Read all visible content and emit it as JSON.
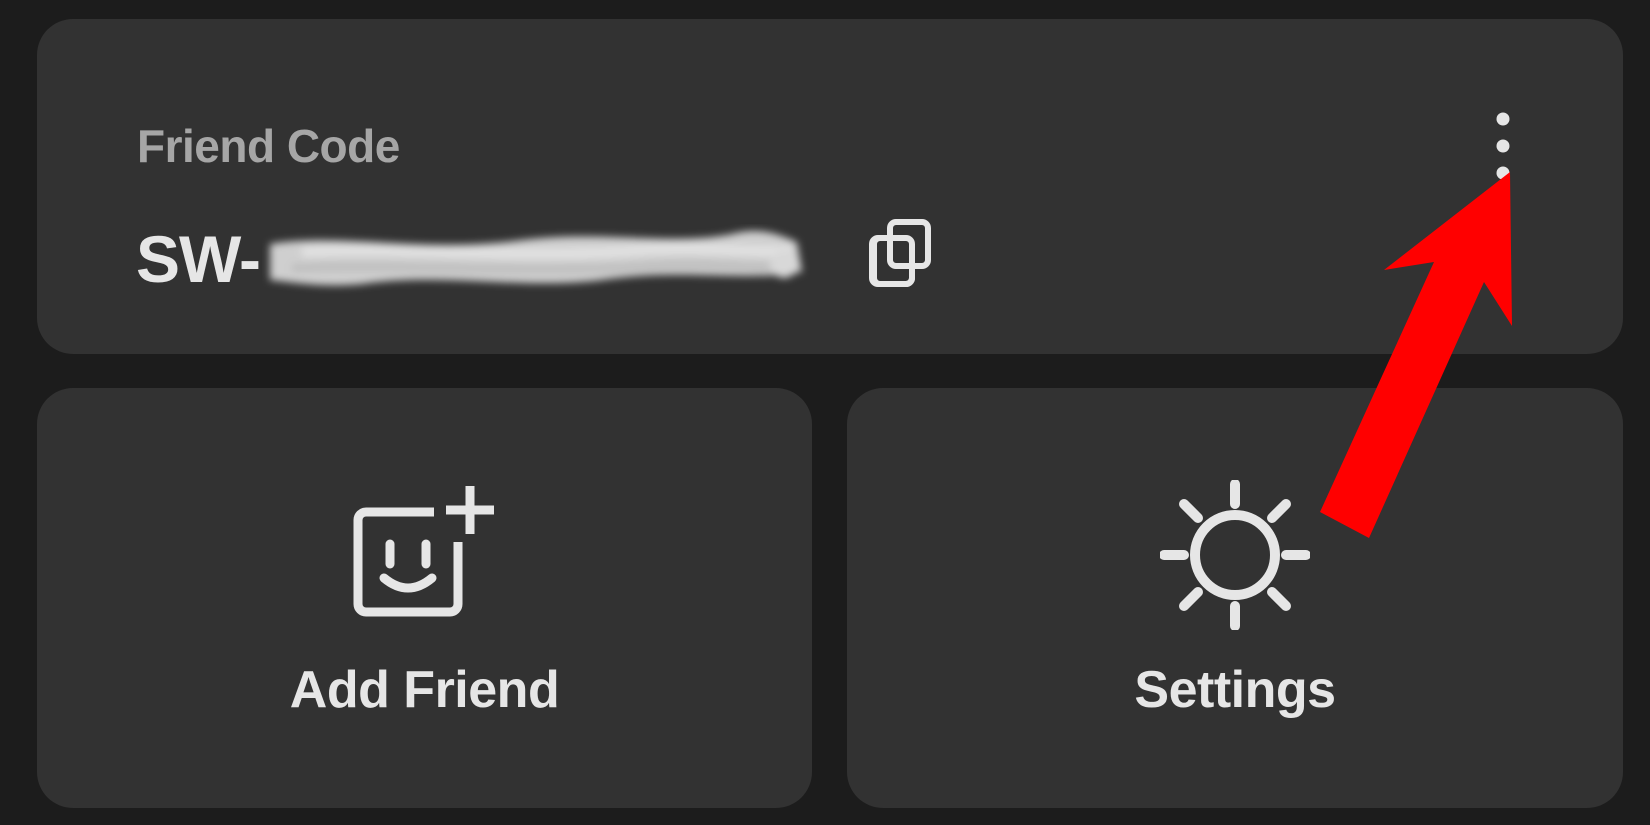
{
  "friend_code": {
    "label": "Friend Code",
    "value_prefix": "SW-",
    "value_redacted": true,
    "copy_icon": "copy-icon",
    "more_icon": "more-vertical-icon"
  },
  "tiles": [
    {
      "label": "Add Friend",
      "icon": "add-friend-icon"
    },
    {
      "label": "Settings",
      "icon": "gear-icon"
    }
  ],
  "annotation": {
    "arrow_color": "#ff0000",
    "points_to": "more-options-button"
  },
  "colors": {
    "background": "#1c1c1c",
    "card": "#323232",
    "label_muted": "#a6a6a6",
    "text": "#e6e6e6"
  }
}
